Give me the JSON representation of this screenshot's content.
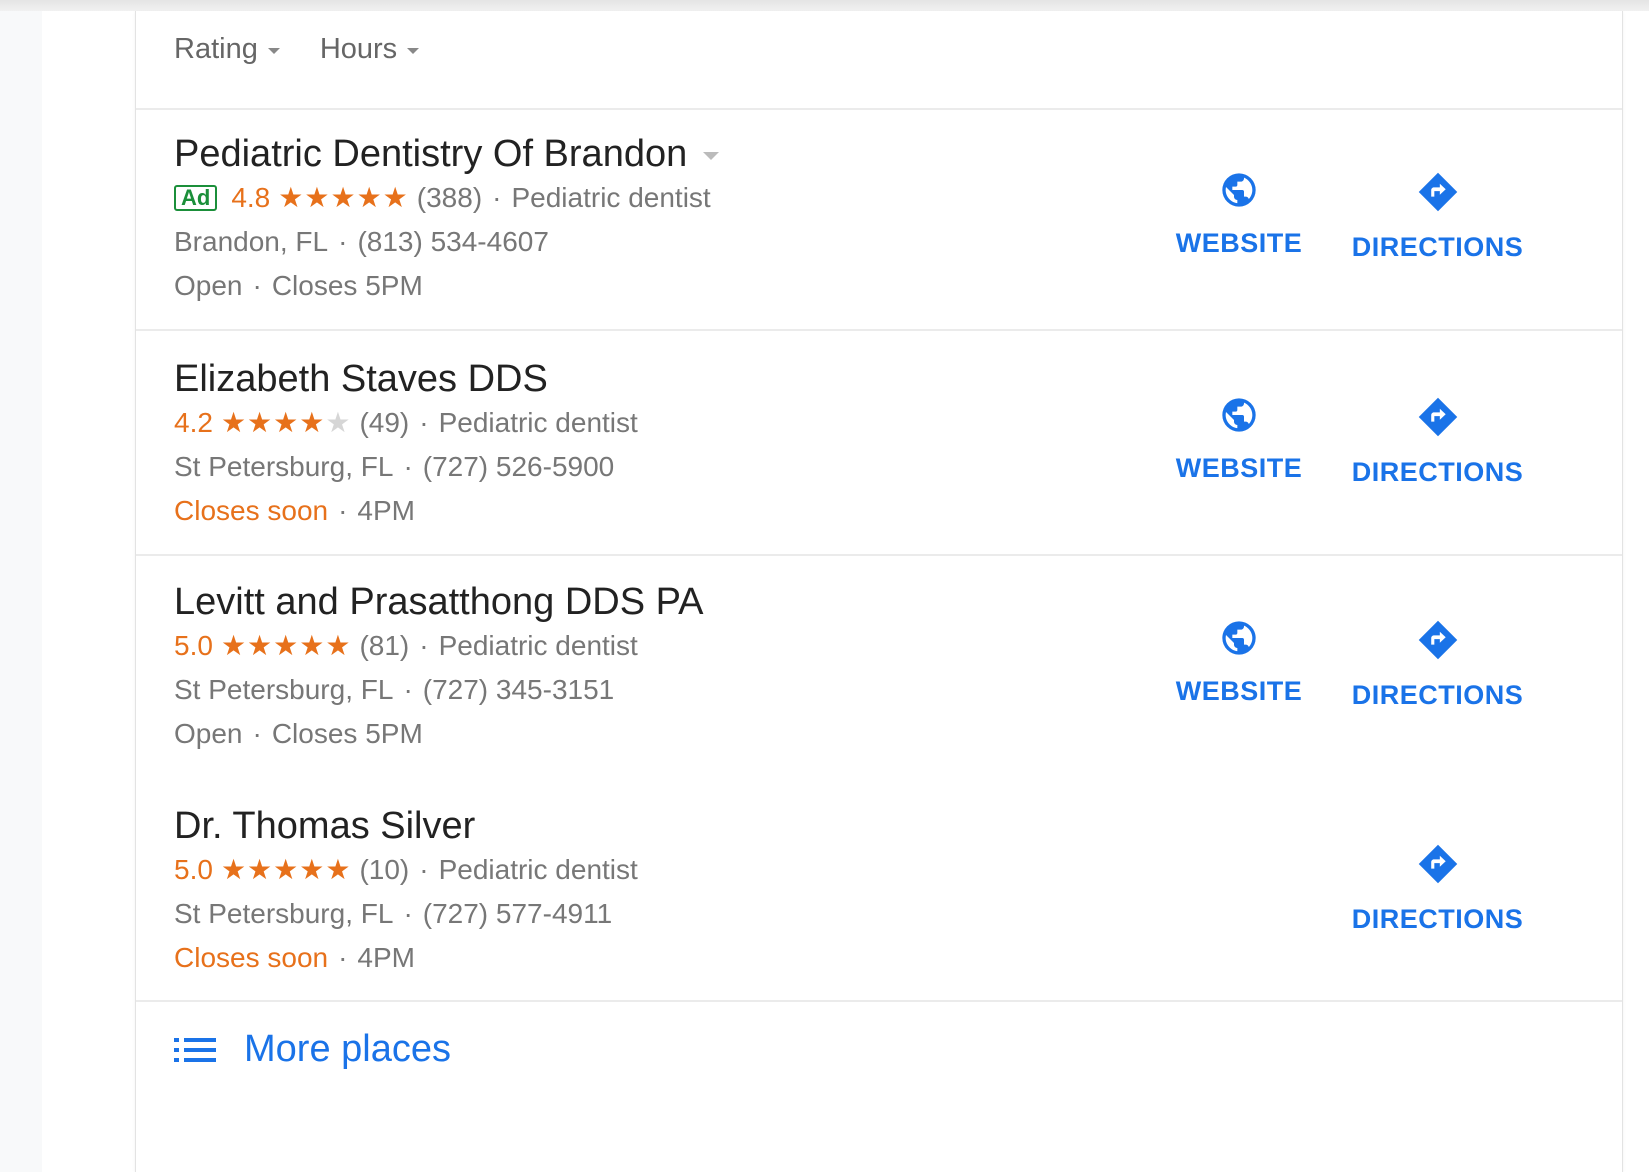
{
  "filters": [
    {
      "label": "Rating"
    },
    {
      "label": "Hours"
    }
  ],
  "listings": [
    {
      "name": "Pediatric Dentistry Of Brandon",
      "ad_label": "Ad",
      "rating": "4.8",
      "stars": "★★★★★",
      "stars_empty": "",
      "reviews": "(388)",
      "category": "Pediatric dentist",
      "location": "Brandon, FL",
      "phone": "(813) 534-4607",
      "status": "Open",
      "hours": "Closes 5PM",
      "has_website": true
    },
    {
      "name": "Elizabeth Staves DDS",
      "rating": "4.2",
      "stars": "★★★★",
      "stars_empty": "★",
      "reviews": "(49)",
      "category": "Pediatric dentist",
      "location": "St Petersburg, FL",
      "phone": "(727) 526-5900",
      "status": "Closes soon",
      "hours": "4PM",
      "has_website": true
    },
    {
      "name": "Levitt and Prasatthong DDS PA",
      "rating": "5.0",
      "stars": "★★★★★",
      "stars_empty": "",
      "reviews": "(81)",
      "category": "Pediatric dentist",
      "location": "St Petersburg, FL",
      "phone": "(727) 345-3151",
      "status": "Open",
      "hours": "Closes 5PM",
      "has_website": true
    },
    {
      "name": "Dr. Thomas Silver",
      "rating": "5.0",
      "stars": "★★★★★",
      "stars_empty": "",
      "reviews": "(10)",
      "category": "Pediatric dentist",
      "location": "St Petersburg, FL",
      "phone": "(727) 577-4911",
      "status": "Closes soon",
      "hours": "4PM",
      "has_website": false
    }
  ],
  "actions": {
    "website_label": "WEBSITE",
    "directions_label": "DIRECTIONS"
  },
  "separator": "·",
  "more_places": {
    "label": "More places"
  },
  "colors": {
    "link_blue": "#1a73e8",
    "rating_orange": "#e7711b",
    "ad_green": "#1b8f3a"
  }
}
